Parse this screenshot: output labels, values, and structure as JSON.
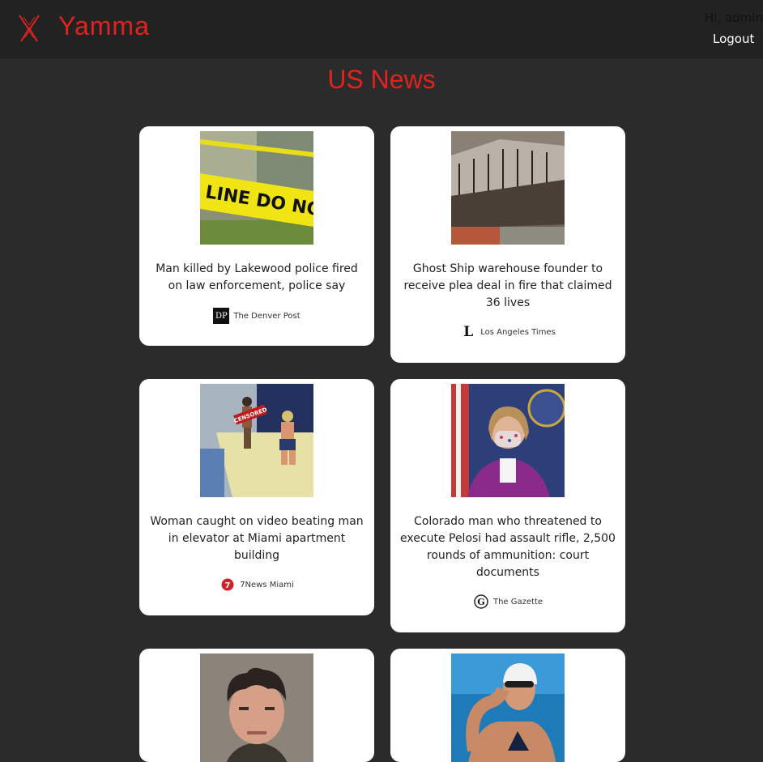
{
  "app": {
    "brand": "Yamma",
    "brand_color": "#e0231f",
    "logo_icon": "scissors-x-icon"
  },
  "user": {
    "greeting": "Hi, admin",
    "logout_label": "Logout"
  },
  "page": {
    "title": "US News"
  },
  "articles": [
    {
      "headline": "Man killed by Lakewood police fired on law enforcement, police say",
      "source": "The Denver Post",
      "source_logo_text": "DP",
      "image": "crime-scene-tape-photo"
    },
    {
      "headline": "Ghost Ship warehouse founder to receive plea deal in fire that claimed 36 lives",
      "source": "Los Angeles Times",
      "source_logo_text": "L",
      "image": "burned-warehouse-photo"
    },
    {
      "headline": "Woman caught on video beating man in elevator at Miami apartment building",
      "source": "7News Miami",
      "source_logo_text": "7",
      "image": "elevator-cctv-photo",
      "image_badge": "CENSORED"
    },
    {
      "headline": "Colorado man who threatened to execute Pelosi had assault rifle, 2,500 rounds of ammunition: court documents",
      "source": "The Gazette",
      "source_logo_text": "G",
      "image": "masked-speaker-photo"
    },
    {
      "headline": "",
      "source": "",
      "image": "mugshot-photo"
    },
    {
      "headline": "",
      "source": "",
      "image": "swimmer-photo"
    }
  ]
}
